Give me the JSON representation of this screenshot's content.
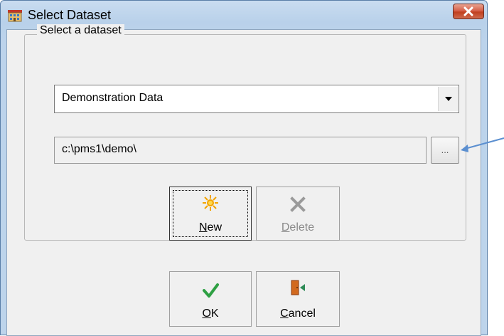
{
  "window": {
    "title": "Select Dataset",
    "close_icon": "close-icon",
    "app_icon": "dataset-app-icon"
  },
  "group": {
    "legend": "Select a dataset"
  },
  "dataset_combo": {
    "value": "Demonstration Data",
    "arrow_icon": "dropdown-arrow-icon"
  },
  "path": {
    "value": "c:\\pms1\\demo\\",
    "browse_label": "..."
  },
  "buttons": {
    "new": {
      "mnemonic": "N",
      "rest": "ew",
      "icon": "sparkle-icon"
    },
    "delete": {
      "mnemonic": "D",
      "rest": "elete",
      "icon": "x-delete-icon"
    },
    "ok": {
      "mnemonic": "O",
      "rest": "K",
      "icon": "checkmark-icon"
    },
    "cancel": {
      "mnemonic": "C",
      "rest": "ancel",
      "icon": "exit-door-icon"
    }
  },
  "colors": {
    "titlebar": "#bcd3eb",
    "client": "#f0f0f0",
    "close_button": "#c75235",
    "annotation_arrow": "#5b8fd0",
    "ok_check": "#2ea043",
    "new_sparkle": "#f2a300"
  }
}
